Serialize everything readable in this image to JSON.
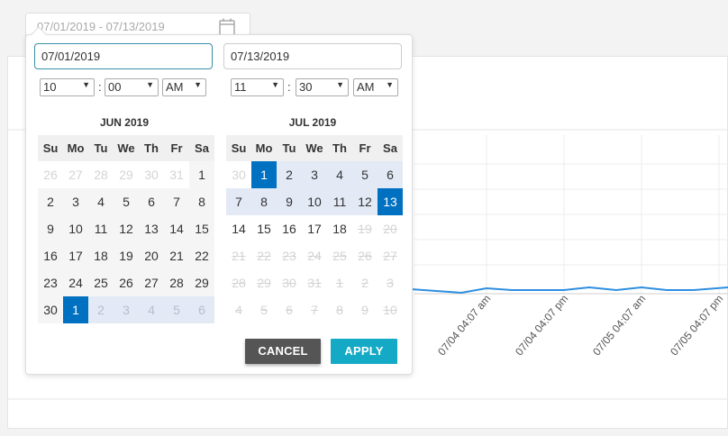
{
  "range_input": {
    "value": "07/01/2019 - 07/13/2019"
  },
  "icons": {
    "calendar": "calendar-icon",
    "dropdown": "chevron-down-icon"
  },
  "colors": {
    "accent": "#0070c0",
    "range": "#e3e9f5",
    "apply": "#14a9c4",
    "cancel": "#555555",
    "line": "#2e8fe0"
  },
  "start": {
    "date": "07/01/2019",
    "hour": "10",
    "minute": "00",
    "ampm": "AM",
    "month_title": "JUN 2019",
    "weekdays": [
      "Su",
      "Mo",
      "Tu",
      "We",
      "Th",
      "Fr",
      "Sa"
    ],
    "days": [
      {
        "d": "26",
        "s": "off"
      },
      {
        "d": "27",
        "s": "off"
      },
      {
        "d": "28",
        "s": "off"
      },
      {
        "d": "29",
        "s": "off"
      },
      {
        "d": "30",
        "s": "off"
      },
      {
        "d": "31",
        "s": "off"
      },
      {
        "d": "1",
        "s": "cur"
      },
      {
        "d": "2",
        "s": "cur"
      },
      {
        "d": "3",
        "s": "cur"
      },
      {
        "d": "4",
        "s": "cur"
      },
      {
        "d": "5",
        "s": "cur"
      },
      {
        "d": "6",
        "s": "cur"
      },
      {
        "d": "7",
        "s": "cur"
      },
      {
        "d": "8",
        "s": "cur"
      },
      {
        "d": "9",
        "s": "cur"
      },
      {
        "d": "10",
        "s": "cur"
      },
      {
        "d": "11",
        "s": "cur"
      },
      {
        "d": "12",
        "s": "cur"
      },
      {
        "d": "13",
        "s": "cur"
      },
      {
        "d": "14",
        "s": "cur"
      },
      {
        "d": "15",
        "s": "cur"
      },
      {
        "d": "16",
        "s": "cur"
      },
      {
        "d": "17",
        "s": "cur"
      },
      {
        "d": "18",
        "s": "cur"
      },
      {
        "d": "19",
        "s": "cur"
      },
      {
        "d": "20",
        "s": "cur"
      },
      {
        "d": "21",
        "s": "cur"
      },
      {
        "d": "22",
        "s": "cur"
      },
      {
        "d": "23",
        "s": "cur"
      },
      {
        "d": "24",
        "s": "cur"
      },
      {
        "d": "25",
        "s": "cur"
      },
      {
        "d": "26",
        "s": "cur"
      },
      {
        "d": "27",
        "s": "cur"
      },
      {
        "d": "28",
        "s": "cur"
      },
      {
        "d": "29",
        "s": "cur"
      },
      {
        "d": "30",
        "s": "cur"
      },
      {
        "d": "1",
        "s": "sel-day"
      },
      {
        "d": "2",
        "s": "inrange off"
      },
      {
        "d": "3",
        "s": "inrange off"
      },
      {
        "d": "4",
        "s": "inrange off"
      },
      {
        "d": "5",
        "s": "inrange off"
      },
      {
        "d": "6",
        "s": "inrange off"
      }
    ]
  },
  "end": {
    "date": "07/13/2019",
    "hour": "11",
    "minute": "30",
    "ampm": "AM",
    "month_title": "JUL 2019",
    "weekdays": [
      "Su",
      "Mo",
      "Tu",
      "We",
      "Th",
      "Fr",
      "Sa"
    ],
    "days": [
      {
        "d": "30",
        "s": "off"
      },
      {
        "d": "1",
        "s": "sel-day"
      },
      {
        "d": "2",
        "s": "inrange"
      },
      {
        "d": "3",
        "s": "inrange"
      },
      {
        "d": "4",
        "s": "inrange"
      },
      {
        "d": "5",
        "s": "inrange"
      },
      {
        "d": "6",
        "s": "inrange"
      },
      {
        "d": "7",
        "s": "inrange"
      },
      {
        "d": "8",
        "s": "inrange"
      },
      {
        "d": "9",
        "s": "inrange"
      },
      {
        "d": "10",
        "s": "inrange"
      },
      {
        "d": "11",
        "s": "inrange"
      },
      {
        "d": "12",
        "s": "inrange"
      },
      {
        "d": "13",
        "s": "sel-day"
      },
      {
        "d": "14",
        "s": "cur alt"
      },
      {
        "d": "15",
        "s": "cur alt"
      },
      {
        "d": "16",
        "s": "cur alt"
      },
      {
        "d": "17",
        "s": "cur alt"
      },
      {
        "d": "18",
        "s": "cur alt"
      },
      {
        "d": "19",
        "s": "strike"
      },
      {
        "d": "20",
        "s": "strike"
      },
      {
        "d": "21",
        "s": "strike"
      },
      {
        "d": "22",
        "s": "strike"
      },
      {
        "d": "23",
        "s": "strike"
      },
      {
        "d": "24",
        "s": "strike"
      },
      {
        "d": "25",
        "s": "strike"
      },
      {
        "d": "26",
        "s": "strike"
      },
      {
        "d": "27",
        "s": "strike"
      },
      {
        "d": "28",
        "s": "strike"
      },
      {
        "d": "29",
        "s": "strike"
      },
      {
        "d": "30",
        "s": "strike"
      },
      {
        "d": "31",
        "s": "strike"
      },
      {
        "d": "1",
        "s": "strike"
      },
      {
        "d": "2",
        "s": "strike"
      },
      {
        "d": "3",
        "s": "strike"
      },
      {
        "d": "4",
        "s": "strike"
      },
      {
        "d": "5",
        "s": "strike"
      },
      {
        "d": "6",
        "s": "strike"
      },
      {
        "d": "7",
        "s": "strike"
      },
      {
        "d": "8",
        "s": "strike"
      },
      {
        "d": "9",
        "s": "strike"
      },
      {
        "d": "10",
        "s": "strike"
      }
    ]
  },
  "buttons": {
    "cancel": "CANCEL",
    "apply": "APPLY"
  },
  "chart": {
    "x_ticks": [
      "07/04 04:07 am",
      "07/04 04:07 pm",
      "07/05 04:07 am",
      "07/05 04:07 pm"
    ]
  }
}
